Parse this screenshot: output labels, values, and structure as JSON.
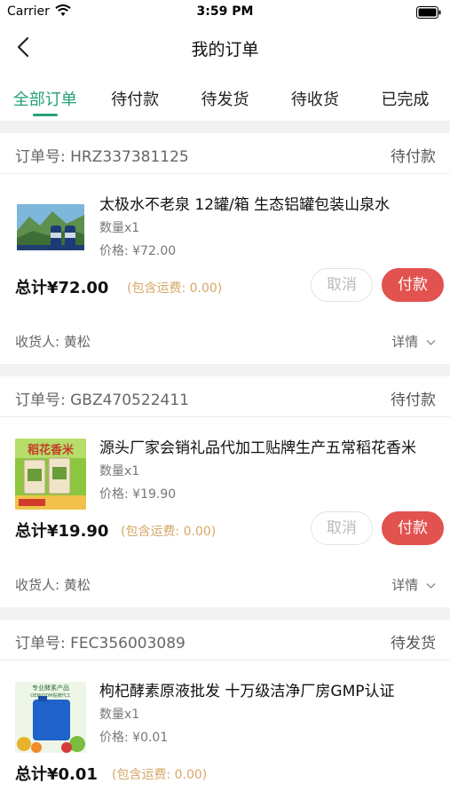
{
  "status_bar": {
    "carrier": "Carrier",
    "time": "3:59 PM"
  },
  "nav": {
    "title": "我的订单"
  },
  "tabs": [
    {
      "label": "全部订单"
    },
    {
      "label": "待付款"
    },
    {
      "label": "待发货"
    },
    {
      "label": "待收货"
    },
    {
      "label": "已完成"
    }
  ],
  "orders": [
    {
      "order_no": "订单号: HRZ337381125",
      "status": "待付款",
      "title": "太极水不老泉 12罐/箱 生态铝罐包装山泉水",
      "qty": "数量x1",
      "price": "价格: ¥72.00",
      "total": "总计¥72.00",
      "shipping": "(包含运费: 0.00)",
      "cancel_label": "取消",
      "pay_label": "付款",
      "receiver": "收货人: 黄松",
      "detail_label": "详情"
    },
    {
      "order_no": "订单号: GBZ470522411",
      "status": "待付款",
      "title": "源头厂家会销礼品代加工贴牌生产五常稻花香米",
      "qty": "数量x1",
      "price": "价格: ¥19.90",
      "total": "总计¥19.90",
      "shipping": "(包含运费: 0.00)",
      "cancel_label": "取消",
      "pay_label": "付款",
      "receiver": "收货人: 黄松",
      "detail_label": "详情"
    },
    {
      "order_no": "订单号: FEC356003089",
      "status": "待发货",
      "title": "枸杞酵素原液批发 十万级洁净厂房GMP认证",
      "qty": "数量x1",
      "price": "价格: ¥0.01",
      "total": "总计¥0.01",
      "shipping": "(包含运费: 0.00)"
    }
  ],
  "image_text": {
    "rice_label": "稻花香米",
    "juice_label": "专业酵素产品",
    "juice_sublabel": "OEM/ODM贴牌代工"
  },
  "colors": {
    "accent": "#27a07a",
    "pay": "#e2524f",
    "shipping": "#d6a766"
  }
}
